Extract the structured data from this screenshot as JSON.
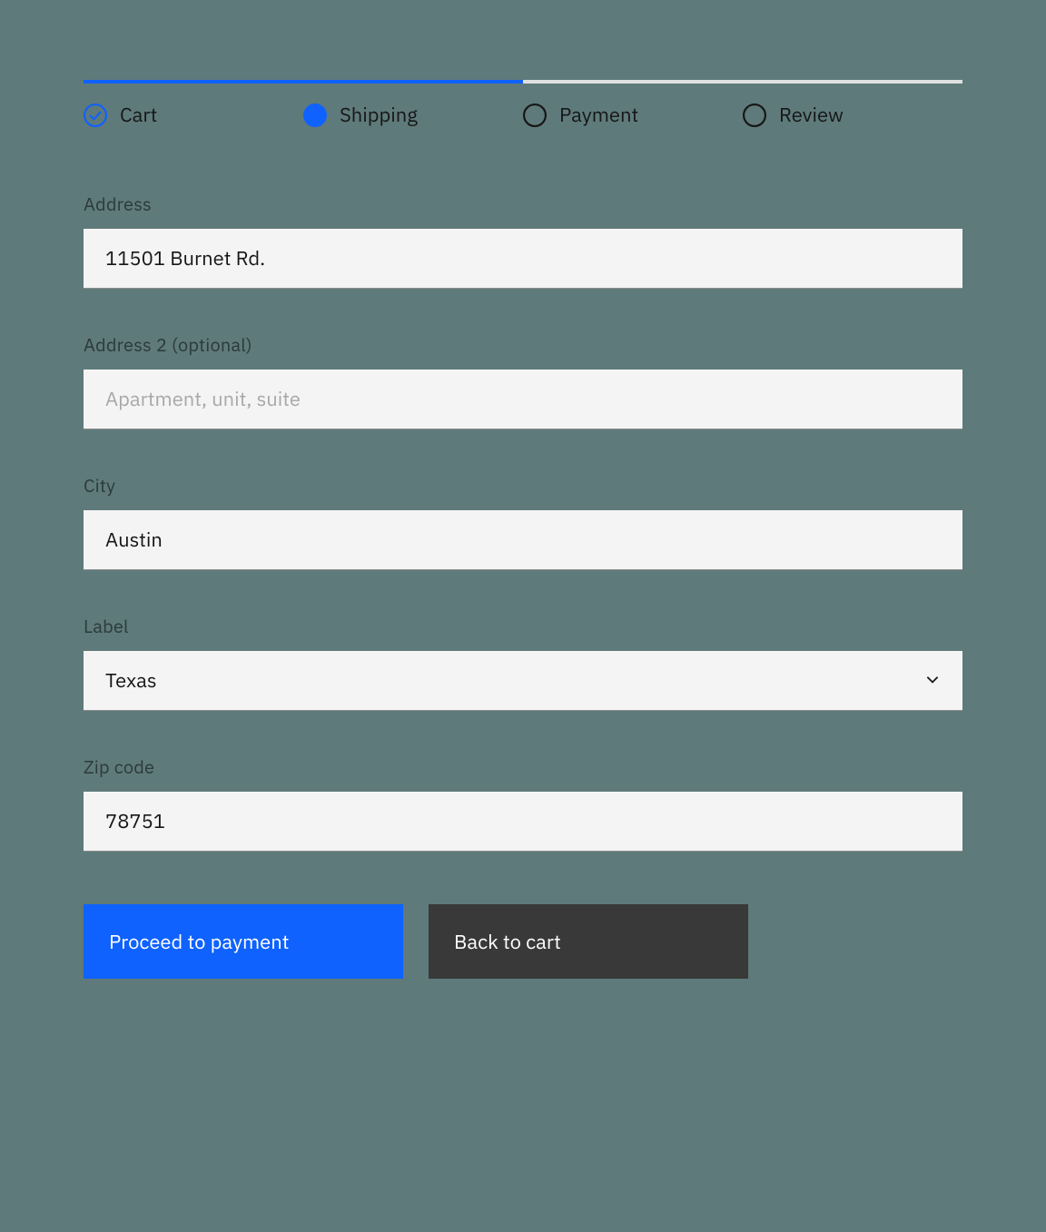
{
  "progress": {
    "steps": [
      {
        "label": "Cart",
        "state": "complete"
      },
      {
        "label": "Shipping",
        "state": "current"
      },
      {
        "label": "Payment",
        "state": "incomplete"
      },
      {
        "label": "Review",
        "state": "incomplete"
      }
    ]
  },
  "form": {
    "address": {
      "label": "Address",
      "value": "11501 Burnet Rd."
    },
    "address2": {
      "label": "Address 2 (optional)",
      "placeholder": "Apartment, unit, suite",
      "value": ""
    },
    "city": {
      "label": "City",
      "value": "Austin"
    },
    "state": {
      "label": "Label",
      "value": "Texas"
    },
    "zip": {
      "label": "Zip code",
      "value": "78751"
    }
  },
  "buttons": {
    "proceed": "Proceed to payment",
    "back": "Back to cart"
  }
}
